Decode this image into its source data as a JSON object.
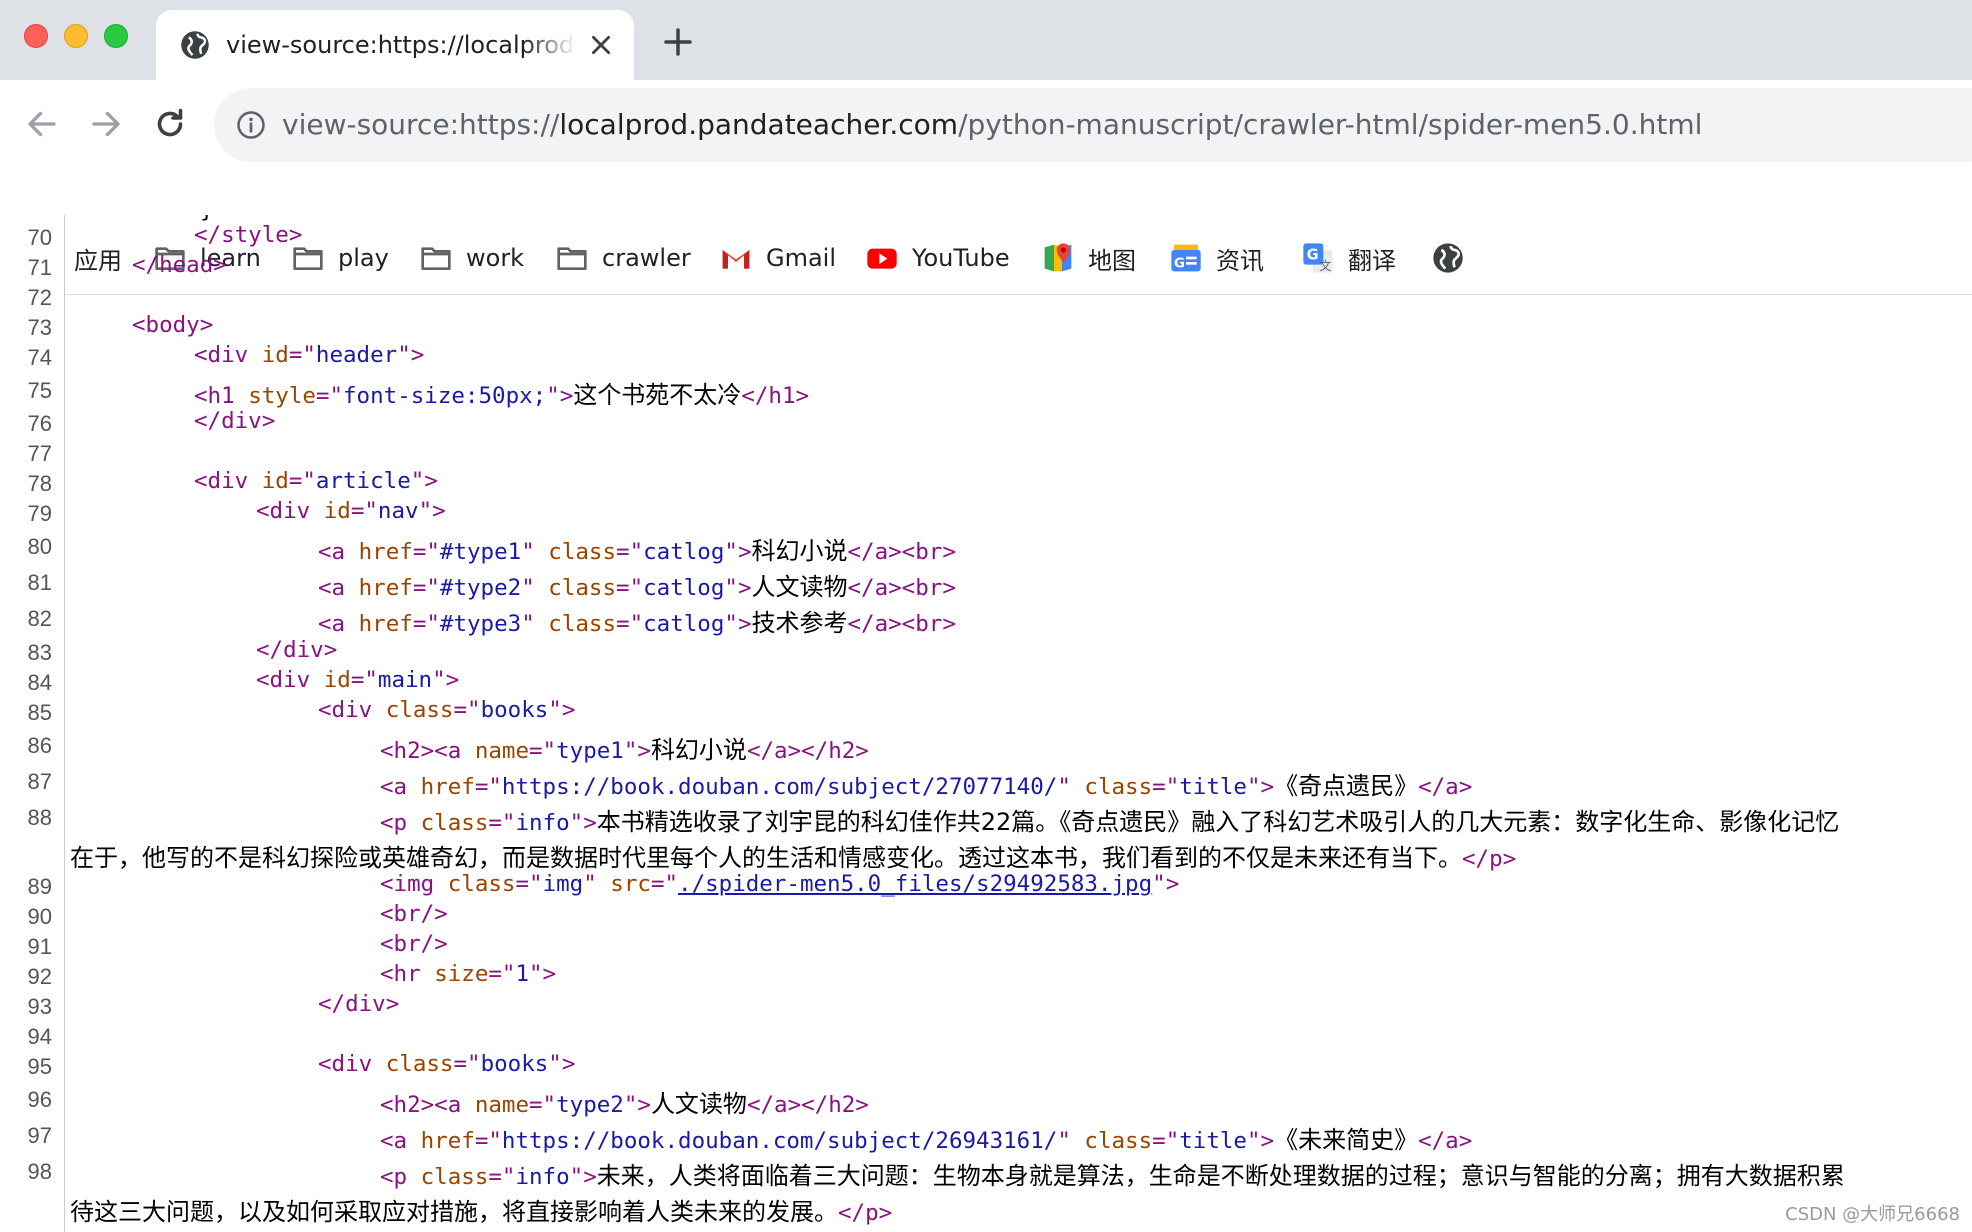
{
  "window": {
    "tab_title": "view-source:https://localprod.pandateacher.com/python-manuscript/crawler-html/spider-men5.0.html"
  },
  "address_bar": {
    "url_scheme": "view-source:https://",
    "url_host": "localprod.pandateacher.com",
    "url_path": "/python-manuscript/crawler-html/spider-men5.0.html"
  },
  "bookmarks": [
    {
      "label": "应用",
      "icon": "apps-grid-icon"
    },
    {
      "label": "learn",
      "icon": "folder-icon"
    },
    {
      "label": "play",
      "icon": "folder-icon"
    },
    {
      "label": "work",
      "icon": "folder-icon"
    },
    {
      "label": "crawler",
      "icon": "folder-icon"
    },
    {
      "label": "Gmail",
      "icon": "gmail-icon"
    },
    {
      "label": "YouTube",
      "icon": "youtube-icon"
    },
    {
      "label": "地图",
      "icon": "maps-icon"
    },
    {
      "label": "资讯",
      "icon": "news-icon"
    },
    {
      "label": "翻译",
      "icon": "translate-icon"
    },
    {
      "label": "",
      "icon": "globe-icon"
    }
  ],
  "source_lines": [
    {
      "n": "70",
      "segments": [
        "</style>"
      ]
    },
    {
      "n": "71",
      "segments": [
        "</head>"
      ]
    },
    {
      "n": "72",
      "segments": []
    },
    {
      "n": "73",
      "segments": [
        "<body>"
      ]
    },
    {
      "n": "74",
      "segments": [
        "<div ",
        "id",
        "=\"",
        "header",
        "\">"
      ]
    },
    {
      "n": "75",
      "segments": [
        "<h1 ",
        "style",
        "=\"",
        "font-size:50px;",
        "\">",
        "这个书苑不太冷",
        "</h1>"
      ]
    },
    {
      "n": "76",
      "segments": [
        "</div>"
      ]
    },
    {
      "n": "77",
      "segments": []
    },
    {
      "n": "78",
      "segments": [
        "<div ",
        "id",
        "=\"",
        "article",
        "\">"
      ]
    },
    {
      "n": "79",
      "segments": [
        "<div ",
        "id",
        "=\"",
        "nav",
        "\">"
      ]
    },
    {
      "n": "80",
      "segments": [
        "<a ",
        "href",
        "=\"",
        "#type1",
        "\" ",
        "class",
        "=\"",
        "catlog",
        "\">",
        "科幻小说",
        "</a><br>"
      ]
    },
    {
      "n": "81",
      "segments": [
        "<a ",
        "href",
        "=\"",
        "#type2",
        "\" ",
        "class",
        "=\"",
        "catlog",
        "\">",
        "人文读物",
        "</a><br>"
      ]
    },
    {
      "n": "82",
      "segments": [
        "<a ",
        "href",
        "=\"",
        "#type3",
        "\" ",
        "class",
        "=\"",
        "catlog",
        "\">",
        "技术参考",
        "</a><br>"
      ]
    },
    {
      "n": "83",
      "segments": [
        "</div>"
      ]
    },
    {
      "n": "84",
      "segments": [
        "<div ",
        "id",
        "=\"",
        "main",
        "\">"
      ]
    },
    {
      "n": "85",
      "segments": [
        "<div ",
        "class",
        "=\"",
        "books",
        "\">"
      ]
    },
    {
      "n": "86",
      "segments": [
        "<h2><a ",
        "name",
        "=\"",
        "type1",
        "\">",
        "科幻小说",
        "</a></h2>"
      ]
    },
    {
      "n": "87",
      "segments": [
        "<a ",
        "href",
        "=\"",
        "https://book.douban.com/subject/27077140/",
        "\" ",
        "class",
        "=\"",
        "title",
        "\">",
        "《奇点遗民》",
        "</a>"
      ]
    },
    {
      "n": "88",
      "segments": [
        "<p ",
        "class",
        "=\"",
        "info",
        "\">",
        "本书精选收录了刘宇昆的科幻佳作共22篇。《奇点遗民》融入了科幻艺术吸引人的几大元素：数字化生命、影像化记忆",
        "在于，他写的不是科幻探险或英雄奇幻，而是数据时代里每个人的生活和情感变化。透过这本书，我们看到的不仅是未来还有当下。",
        "</p>"
      ]
    },
    {
      "n": "89",
      "segments": [
        "<img ",
        "class",
        "=\"",
        "img",
        "\" ",
        "src",
        "=\"",
        "./spider-men5.0_files/s29492583.jpg",
        "\">"
      ]
    },
    {
      "n": "90",
      "segments": [
        "<br/>"
      ]
    },
    {
      "n": "91",
      "segments": [
        "<br/>"
      ]
    },
    {
      "n": "92",
      "segments": [
        "<hr ",
        "size",
        "=\"",
        "1",
        "\">"
      ]
    },
    {
      "n": "93",
      "segments": [
        "</div>"
      ]
    },
    {
      "n": "94",
      "segments": []
    },
    {
      "n": "95",
      "segments": [
        "<div ",
        "class",
        "=\"",
        "books",
        "\">"
      ]
    },
    {
      "n": "96",
      "segments": [
        "<h2><a ",
        "name",
        "=\"",
        "type2",
        "\">",
        "人文读物",
        "</a></h2>"
      ]
    },
    {
      "n": "97",
      "segments": [
        "<a ",
        "href",
        "=\"",
        "https://book.douban.com/subject/26943161/",
        "\" ",
        "class",
        "=\"",
        "title",
        "\">",
        "《未来简史》",
        "</a>"
      ]
    },
    {
      "n": "98",
      "segments": [
        "<p ",
        "class",
        "=\"",
        "info",
        "\">",
        "未来，人类将面临着三大问题：生物本身就是算法，生命是不断处理数据的过程；意识与智能的分离；拥有大数据积累",
        "待这三大问题，以及如何采取应对措施，将直接影响着人类未来的发展。",
        "</p>"
      ]
    }
  ],
  "watermark": "CSDN @大师兄6668"
}
